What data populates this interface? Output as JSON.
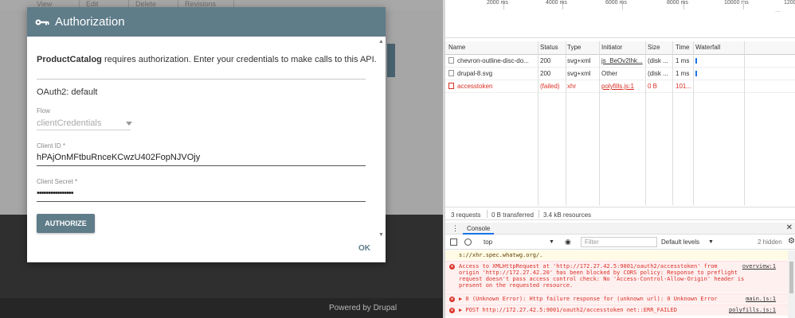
{
  "page_behind": {
    "tabs": [
      "View",
      "Edit",
      "Delete",
      "Revisions"
    ],
    "footer_text": "Powered by Drupal"
  },
  "modal": {
    "title": "Authorization",
    "description_bold": "ProductCatalog",
    "description_rest": " requires authorization. Enter your credentials to make calls to this API.",
    "oauth_label": "OAuth2: default",
    "flow": {
      "label": "Flow",
      "value": "clientCredentials"
    },
    "client_id": {
      "label": "Client ID *",
      "value": "hPAjOnMFtbuRnceKCwzU402FopNJVOjy"
    },
    "client_secret": {
      "label": "Client Secret *",
      "value": "••••••••••••••••"
    },
    "authorize_label": "AUTHORIZE",
    "ok_label": "OK",
    "colors": {
      "header": "#5f7c89"
    }
  },
  "devtools": {
    "timeline_ticks": [
      "2000 ms",
      "4000 ms",
      "6000 ms",
      "8000 ms",
      "10000 ms",
      "1200"
    ],
    "timeline_more": "...",
    "columns": [
      "Name",
      "Status",
      "Type",
      "Initiator",
      "Size",
      "Time",
      "Waterfall"
    ],
    "rows": [
      {
        "name": "chevron-outline-disc-do...",
        "status": "200",
        "type": "svg+xml",
        "initiator": "js_BeOv2lhk...",
        "size": "(disk ...",
        "time": "1 ms",
        "error": false
      },
      {
        "name": "drupal-8.svg",
        "status": "200",
        "type": "svg+xml",
        "initiator": "Other",
        "size": "(disk ...",
        "time": "1 ms",
        "error": false
      },
      {
        "name": "accesstoken",
        "status": "(failed)",
        "type": "xhr",
        "initiator": "polyfills.js:1",
        "size": "0 B",
        "time": "101...",
        "error": true
      }
    ],
    "summary": {
      "requests": "3 requests",
      "transferred": "0 B transferred",
      "resources": "3.4 kB resources"
    },
    "drawer_tab": "Console",
    "console_toolbar": {
      "context": "top",
      "filter_placeholder": "Filter",
      "levels": "Default levels",
      "hidden": "2 hidden"
    },
    "messages": [
      {
        "kind": "warn",
        "lines": [
          "s://xhr.spec.whatwg.org/."
        ]
      },
      {
        "kind": "error",
        "lines": [
          "Access to XMLHttpRequest at 'http://172.27.42.5:9001/oauth2/accesstoken' from",
          "origin 'http://172.27.42.20' has been blocked by CORS policy: Response to preflight",
          "request doesn't pass access control check: No 'Access-Control-Allow-Origin' header is",
          "present on the requested resource."
        ],
        "source": "overview:1"
      },
      {
        "kind": "error",
        "lines": [
          "▶ 0 (Unknown Error): Http failure response for (unknown url): 0 Unknown Error"
        ],
        "source": "main.js:1"
      },
      {
        "kind": "error",
        "lines": [
          "▶ POST http://172.27.42.5:9001/oauth2/accesstoken net::ERR_FAILED"
        ],
        "source": "polyfills.js:1"
      }
    ]
  }
}
